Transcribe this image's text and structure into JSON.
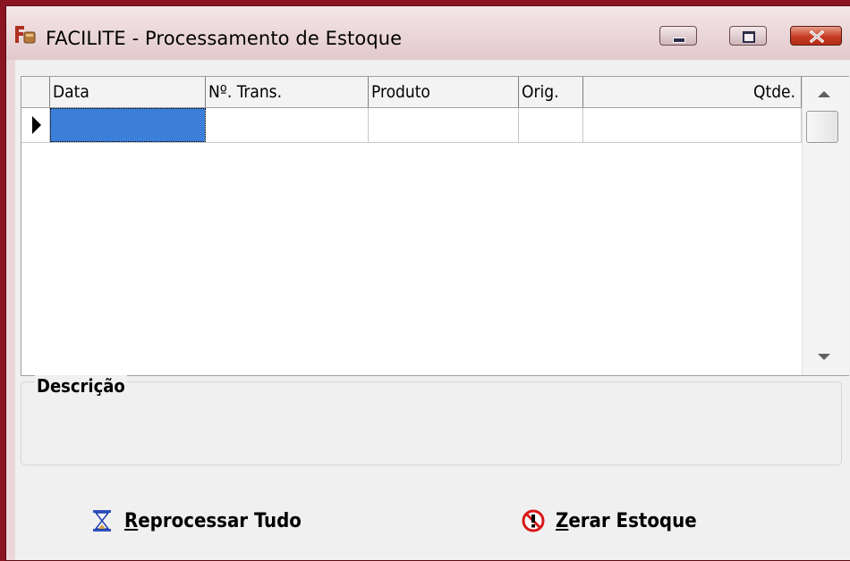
{
  "window": {
    "title": "FACILITE - Processamento de Estoque",
    "app_icon": "facilite-app-icon",
    "controls": [
      "minimize-icon",
      "maximize-icon",
      "close-icon"
    ]
  },
  "grid": {
    "columns": [
      "Data",
      "Nº. Trans.",
      "Produto",
      "Orig.",
      "Qtde."
    ],
    "rows": [
      {
        "Data": "",
        "Nº. Trans.": "",
        "Produto": "",
        "Orig.": "",
        "Qtde.": ""
      }
    ],
    "selected_row": 0,
    "selected_column": "Data"
  },
  "description": {
    "label": "Descrição",
    "value": ""
  },
  "actions": {
    "reprocess": {
      "mnemonic": "R",
      "rest": "eprocessar Tudo",
      "icon": "hourglass-icon"
    },
    "zerar": {
      "mnemonic": "Z",
      "rest": "erar Estoque",
      "icon": "no-entry-icon"
    }
  },
  "colors": {
    "desktop": "#8a1420",
    "selection": "#3b7fd8",
    "close_button": "#c73b24"
  }
}
